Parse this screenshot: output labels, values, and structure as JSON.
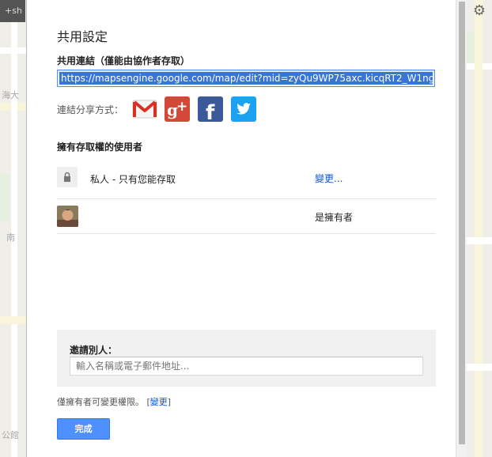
{
  "background": {
    "topbar_text": "+sh",
    "map_labels": [
      "海大",
      "南",
      "公館"
    ]
  },
  "dialog": {
    "title": "共用設定",
    "share_link": {
      "label": "共用連結（僅能由協作者存取）",
      "url": "https://mapsengine.google.com/map/edit?mid=zyQu9WP75axc.kicqRT2_W1ng"
    },
    "share_via": {
      "label": "連結分享方式：",
      "services": [
        {
          "name": "gmail-icon",
          "label": "Gmail"
        },
        {
          "name": "google-plus-icon",
          "label": "Google+"
        },
        {
          "name": "facebook-icon",
          "label": "Facebook"
        },
        {
          "name": "twitter-icon",
          "label": "Twitter"
        }
      ]
    },
    "access": {
      "label": "擁有存取權的使用者",
      "rows": [
        {
          "icon": "lock-icon",
          "text": "私人 - 只有您能存取",
          "action": "變更..."
        },
        {
          "icon": "avatar",
          "text": "",
          "role": "是擁有者"
        }
      ]
    },
    "invite": {
      "label": "邀請別人：",
      "placeholder": "輸入名稱或電子郵件地址...",
      "value": ""
    },
    "footer_note": {
      "text": "僅擁有者可變更權限。",
      "bracket_open": "[",
      "link": "變更",
      "bracket_close": "]"
    },
    "done_label": "完成"
  },
  "colors": {
    "primary_button": "#4d90fe",
    "link": "#1155cc",
    "selection": "#3875d7"
  }
}
